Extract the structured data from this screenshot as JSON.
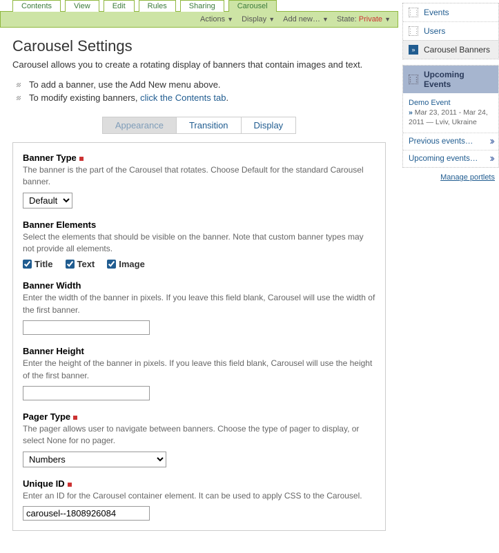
{
  "top_tabs": [
    "Contents",
    "View",
    "Edit",
    "Rules",
    "Sharing",
    "Carousel"
  ],
  "top_tab_active": 5,
  "action_bar": {
    "actions": "Actions",
    "display": "Display",
    "add_new": "Add new…",
    "state_label": "State:",
    "state_value": "Private"
  },
  "page": {
    "title": "Carousel Settings",
    "intro": "Carousel allows you to create a rotating display of banners that contain images and text.",
    "bullets": [
      {
        "text": "To add a banner, use the Add New menu above."
      },
      {
        "prefix": "To modify existing banners, ",
        "link": "click the Contents tab",
        "suffix": "."
      }
    ]
  },
  "inner_tabs": [
    "Appearance",
    "Transition",
    "Display"
  ],
  "inner_tab_active": 0,
  "fields": {
    "banner_type": {
      "label": "Banner Type",
      "required": true,
      "help": "The banner is the part of the Carousel that rotates. Choose Default for the standard Carousel banner.",
      "value": "Default"
    },
    "banner_elements": {
      "label": "Banner Elements",
      "help": "Select the elements that should be visible on the banner. Note that custom banner types may not provide all elements.",
      "options": [
        {
          "label": "Title",
          "checked": true
        },
        {
          "label": "Text",
          "checked": true
        },
        {
          "label": "Image",
          "checked": true
        }
      ]
    },
    "banner_width": {
      "label": "Banner Width",
      "help": "Enter the width of the banner in pixels. If you leave this field blank, Carousel will use the width of the first banner.",
      "value": ""
    },
    "banner_height": {
      "label": "Banner Height",
      "help": "Enter the height of the banner in pixels. If you leave this field blank, Carousel will use the height of the first banner.",
      "value": ""
    },
    "pager_type": {
      "label": "Pager Type",
      "required": true,
      "help": "The pager allows user to navigate between banners. Choose the type of pager to display, or select None for no pager.",
      "value": "Numbers"
    },
    "unique_id": {
      "label": "Unique ID",
      "required": true,
      "help": "Enter an ID for the Carousel container element. It can be used to apply CSS to the Carousel.",
      "value": "carousel--1808926084"
    }
  },
  "sidebar": {
    "nav": [
      "Events",
      "Users",
      "Carousel Banners"
    ],
    "nav_active": 2,
    "portlet_title": "Upcoming Events",
    "event": {
      "title": "Demo Event",
      "meta": "Mar 23, 2011 - Mar 24, 2011 — Lviv, Ukraine"
    },
    "links": [
      "Previous events…",
      "Upcoming events…"
    ],
    "manage": "Manage portlets"
  }
}
